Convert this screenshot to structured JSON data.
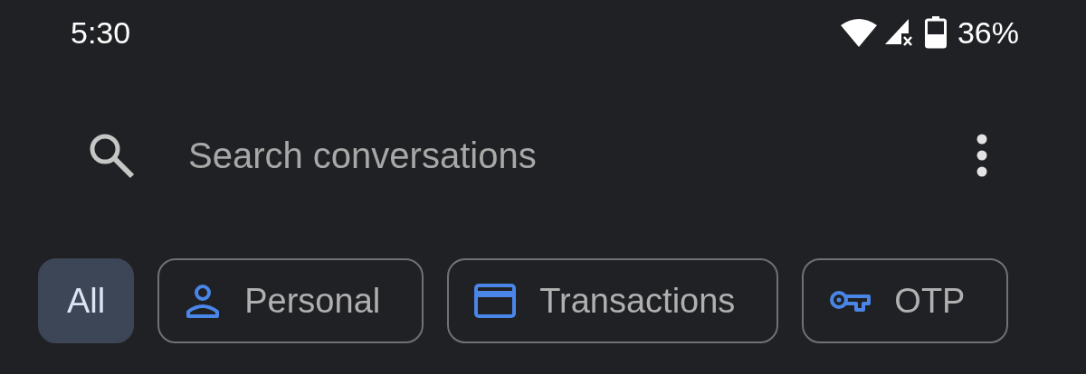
{
  "status_bar": {
    "time": "5:30",
    "battery": "36%"
  },
  "search": {
    "placeholder": "Search conversations"
  },
  "filters": [
    {
      "label": "All",
      "kind": "plain",
      "selected": true
    },
    {
      "label": "Personal",
      "kind": "person",
      "selected": false
    },
    {
      "label": "Transactions",
      "kind": "card",
      "selected": false
    },
    {
      "label": "OTP",
      "kind": "key",
      "selected": false
    }
  ]
}
